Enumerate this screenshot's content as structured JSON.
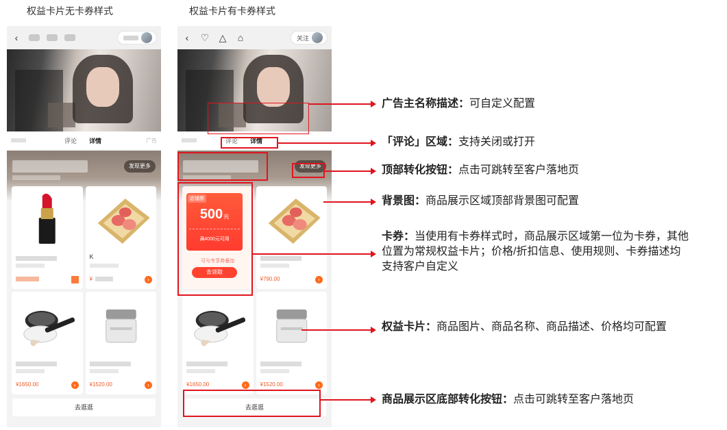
{
  "columns": {
    "left_title": "权益卡片无卡券样式",
    "right_title": "权益卡片有卡券样式"
  },
  "phone": {
    "follow_label": "关注",
    "tabs": [
      "评论",
      "详情"
    ],
    "tab_ad": "广告",
    "discover_more": "发现更多",
    "bottom_button": "去逛逛",
    "k_letter": "K"
  },
  "products_left": [
    {
      "price": ""
    },
    {
      "price": "¥"
    },
    {
      "price": "¥1650.00"
    },
    {
      "price": "¥1520.00"
    }
  ],
  "products_right": [
    {
      "price": "¥790.00"
    },
    {
      "price": "¥1650.00"
    },
    {
      "price": "¥1520.00"
    }
  ],
  "coupon": {
    "tag": "店铺券",
    "amount": "500",
    "unit": "元",
    "condition": "满4000元可用",
    "rule": "可与专享券叠加",
    "claim": "去领取"
  },
  "annotations": [
    {
      "key": "广告主名称描述：",
      "text": "可自定义配置"
    },
    {
      "key": "「评论」区域：",
      "text": "支持关闭或打开"
    },
    {
      "key": "顶部转化按钮：",
      "text": "点击可跳转至客户落地页"
    },
    {
      "key": "背景图：",
      "text": "商品展示区域顶部背景图可配置"
    },
    {
      "key": "卡券：",
      "text": "当使用有卡券样式时，商品展示区域第一位为卡券，其他位置为常规权益卡片；价格/折扣信息、使用规则、卡券描述均支持客户自定义"
    },
    {
      "key": "权益卡片：",
      "text": "商品图片、商品名称、商品描述、价格均可配置"
    },
    {
      "key": "商品展示区底部转化按钮：",
      "text": "点击可跳转至客户落地页"
    }
  ],
  "colors": {
    "accent": "#e0141e",
    "price": "#f05a28",
    "cart": "#ff6a1a"
  }
}
